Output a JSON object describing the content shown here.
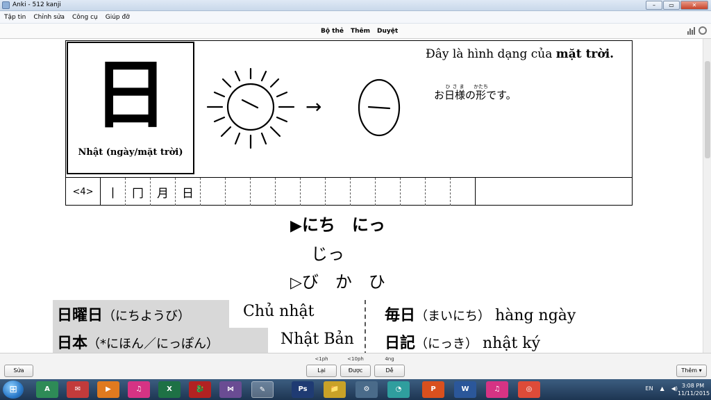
{
  "window": {
    "title": "Anki - 512 kanji",
    "controls": {
      "minimize": "–",
      "maximize": "▭",
      "close": "✕"
    }
  },
  "menu": [
    "Tập tin",
    "Chỉnh sửa",
    "Công cụ",
    "Giúp đỡ"
  ],
  "toolbar": {
    "decks": "Bộ thẻ",
    "add": "Thêm",
    "browse": "Duyệt"
  },
  "card": {
    "kanji": "日",
    "meaning": "Nhật (ngày/mặt trời)",
    "arrow": "→",
    "description_pre": "Đây là hình dạng của ",
    "description_bold": "mặt trời.",
    "furigana_sentence": {
      "prefix": "お",
      "base1": "日様",
      "rt1": "ひさま",
      "mid": "の",
      "base2": "形",
      "rt2": "かたち",
      "suffix": "です。"
    },
    "stroke_count": "<4>",
    "stroke_steps": [
      "丨",
      "冂",
      "月",
      "日"
    ],
    "readings": {
      "on_marker": "▶",
      "on_line1": "にち　にっ",
      "on_line2": "じっ",
      "kun_marker": "▷",
      "kun_line": "び　か　ひ"
    },
    "vocab": [
      {
        "kanji": "日曜日",
        "reading": "（にちようび）",
        "meaning": "Chủ nhật"
      },
      {
        "kanji": "日本",
        "reading": "（*にほん／にっぽん）",
        "meaning": "Nhật Bản"
      },
      {
        "kanji": "毎日",
        "reading": "（まいにち）",
        "meaning": "hàng ngày"
      },
      {
        "kanji": "日記",
        "reading": "（にっき）",
        "meaning": "nhật ký"
      }
    ]
  },
  "bottom": {
    "edit": "Sửa",
    "again": "Lại",
    "again_due": "<1ph",
    "good": "Được",
    "good_due": "<10ph",
    "easy": "Dễ",
    "easy_due": "4ng",
    "more": "Thêm ▾"
  },
  "taskbar": {
    "start": "⊞",
    "lang": "EN",
    "time": "3:08 PM",
    "date": "11/11/2015",
    "apps": [
      "A",
      "✉",
      "▶",
      "♫",
      "X",
      "🐉",
      "⋈",
      "✎",
      "Ps",
      "📁",
      "⚙",
      "◔",
      "P",
      "W",
      "♫",
      "◎"
    ]
  }
}
